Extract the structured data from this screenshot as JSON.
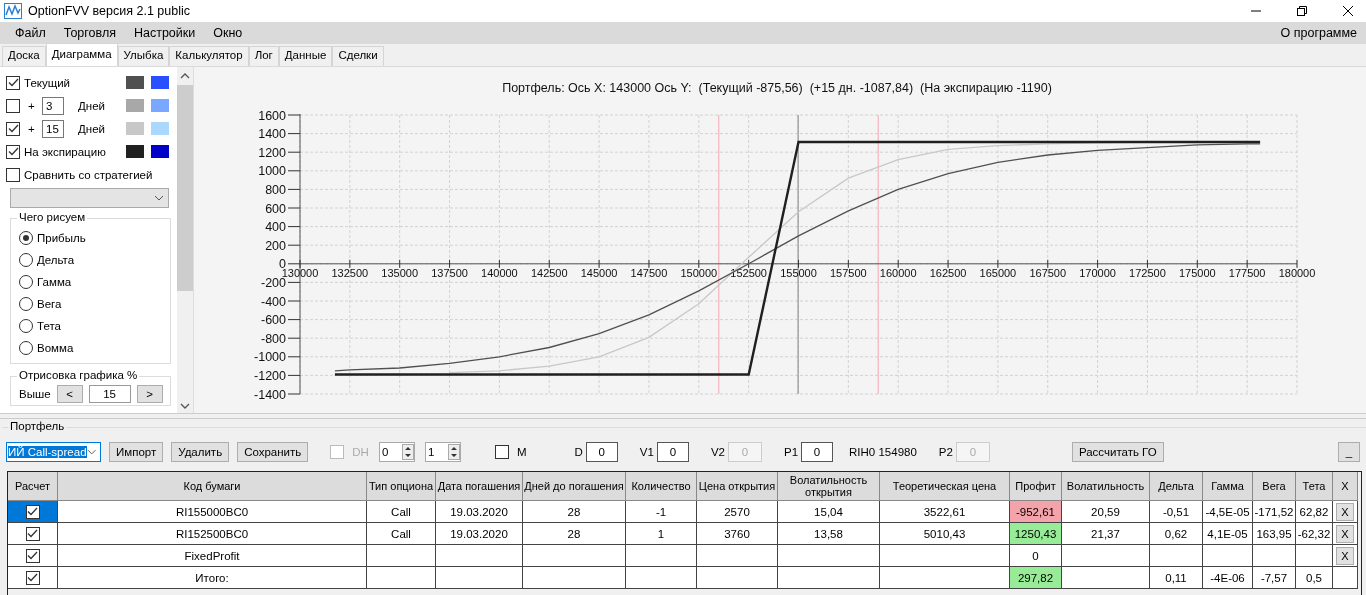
{
  "window": {
    "title": "OptionFVV версия 2.1 public"
  },
  "menu": [
    "Файл",
    "Торговля",
    "Настройки",
    "Окно"
  ],
  "menu_right": "О программе",
  "tabs": [
    {
      "label": "Доска",
      "selected": false
    },
    {
      "label": "Диаграмма",
      "selected": true
    },
    {
      "label": "Улыбка",
      "selected": false
    },
    {
      "label": "Калькулятор",
      "selected": false
    },
    {
      "label": "Лог",
      "selected": false
    },
    {
      "label": "Данные",
      "selected": false
    },
    {
      "label": "Сделки",
      "selected": false
    }
  ],
  "curves": [
    {
      "kind": "plain",
      "label": "Текущий",
      "checked": true,
      "swatches": [
        {
          "color": "#505050"
        },
        {
          "color": "#2a4fff"
        }
      ]
    },
    {
      "kind": "days",
      "prefix": "+",
      "days": "3",
      "unit": "Дней",
      "checked": false,
      "swatches": [
        {
          "color": "#a8a8a8"
        },
        {
          "color": "#7aa7ff"
        }
      ]
    },
    {
      "kind": "days",
      "prefix": "+",
      "days": "15",
      "unit": "Дней",
      "checked": true,
      "swatches": [
        {
          "color": "#c8c8c8"
        },
        {
          "color": "#aad8ff"
        }
      ]
    },
    {
      "kind": "plain",
      "label": "На экспирацию",
      "checked": true,
      "swatches": [
        {
          "color": "#202020"
        },
        {
          "color": "#0000c8"
        }
      ]
    }
  ],
  "compare": {
    "label": "Сравнить со стратегией",
    "checked": false
  },
  "strategy_select": {
    "disabled": true
  },
  "plot_group": {
    "title": "Чего рисуем",
    "options": [
      {
        "label": "Прибыль",
        "selected": true
      },
      {
        "label": "Дельта",
        "selected": false
      },
      {
        "label": "Гамма",
        "selected": false
      },
      {
        "label": "Вега",
        "selected": false
      },
      {
        "label": "Тета",
        "selected": false
      },
      {
        "label": "Вомма",
        "selected": false
      }
    ]
  },
  "range_group": {
    "title": "Отрисовка графика %",
    "label": "Выше",
    "dec": "<",
    "value": "15",
    "inc": ">"
  },
  "chart": {
    "chart_data": {
      "type": "line",
      "title": "Портфель: Ось X: 143000 Ось Y:  (Текущий -875,56)  (+15 дн. -1087,84)  (На экспирацию -1190)",
      "x": [
        131750,
        132500,
        135000,
        137500,
        140000,
        142500,
        145000,
        147500,
        150000,
        152500,
        155000,
        157500,
        160000,
        162500,
        165000,
        167500,
        170000,
        172500,
        175000,
        177500,
        178150
      ],
      "series": [
        {
          "color": "#c8c8c8",
          "values": [
            null,
            null,
            null,
            -1170,
            -1150,
            -1100,
            -1000,
            -790,
            -430,
            70,
            560,
            920,
            1120,
            1230,
            1270,
            1290,
            1300,
            1310,
            1310,
            1310,
            1310
          ]
        },
        {
          "color": "#505050",
          "values": [
            -1150,
            -1140,
            -1120,
            -1070,
            -1000,
            -900,
            -750,
            -550,
            -290,
            0,
            300,
            570,
            800,
            970,
            1090,
            1170,
            1220,
            1250,
            1280,
            1290,
            1290
          ]
        },
        {
          "color": "#202020",
          "values": [
            -1190,
            -1190,
            -1190,
            -1190,
            -1190,
            -1190,
            -1190,
            -1190,
            -1190,
            -1190,
            1310,
            1310,
            1310,
            1310,
            1310,
            1310,
            1310,
            1310,
            1310,
            1310,
            1310
          ]
        }
      ],
      "xlim": [
        130000,
        180000
      ],
      "ylim": [
        -1400,
        1600
      ],
      "grid": true,
      "xticks": [
        130000,
        132500,
        135000,
        137500,
        140000,
        142500,
        145000,
        147500,
        150000,
        152500,
        155000,
        157500,
        160000,
        162500,
        165000,
        167500,
        170000,
        172500,
        175000,
        177500,
        180000
      ],
      "yticks": [
        -1400,
        -1200,
        -1000,
        -800,
        -600,
        -400,
        -200,
        0,
        200,
        400,
        600,
        800,
        1000,
        1200,
        1400,
        1600
      ],
      "ref_lines": [
        {
          "axis": "x",
          "value": 151000,
          "color": "#f4b8c4"
        },
        {
          "axis": "x",
          "value": 159000,
          "color": "#f4b8c4"
        },
        {
          "axis": "x",
          "value": 154980,
          "color": "#9a9a9a"
        }
      ]
    }
  },
  "portfolio": {
    "title": "Портфель",
    "strategy": "ИЙ Call-spread",
    "buttons": [
      "Импорт",
      "Удалить",
      "Сохранить"
    ],
    "dh": {
      "label": "DH",
      "checked": false,
      "disabled": true
    },
    "spinners": [
      "0",
      "1"
    ],
    "m": {
      "label": "M",
      "checked": false
    },
    "items": [
      {
        "kind": "field",
        "label": "D",
        "value": "0",
        "disabled": false
      },
      {
        "kind": "field",
        "label": "V1",
        "value": "0",
        "disabled": false
      },
      {
        "kind": "field",
        "label": "V2",
        "value": "0",
        "disabled": true
      },
      {
        "kind": "field",
        "label": "P1",
        "value": "0",
        "disabled": false
      },
      {
        "kind": "text",
        "text": "RIH0 154980"
      },
      {
        "kind": "field",
        "label": "P2",
        "value": "0",
        "disabled": true
      }
    ],
    "go_button": "Рассчитать ГО",
    "collapse_button": "_"
  },
  "table": {
    "columns": [
      "Расчет",
      "Код бумаги",
      "Тип опциона",
      "Дата погашения",
      "Дней до погашения",
      "Количество",
      "Цена открытия",
      "Волатильность открытия",
      "Теоретическая цена",
      "Профит",
      "Волатильность",
      "Дельта",
      "Гамма",
      "Вега",
      "Тета",
      "X"
    ],
    "rows": [
      {
        "checked": true,
        "selected": true,
        "code": "RI155000BC0",
        "type": "Call",
        "date": "19.03.2020",
        "days": "28",
        "qty": "-1",
        "open_price": "2570",
        "open_vol": "15,04",
        "theo": "3522,61",
        "profit": {
          "text": "-952,61",
          "color": "#f4a3aa"
        },
        "vol": "20,59",
        "delta": "-0,51",
        "gamma": "-4,5E-05",
        "vega": "-171,52",
        "theta": "62,82",
        "remove": "X"
      },
      {
        "checked": true,
        "selected": false,
        "code": "RI152500BC0",
        "type": "Call",
        "date": "19.03.2020",
        "days": "28",
        "qty": "1",
        "open_price": "3760",
        "open_vol": "13,58",
        "theo": "5010,43",
        "profit": {
          "text": "1250,43",
          "color": "#98ec98"
        },
        "vol": "21,37",
        "delta": "0,62",
        "gamma": "4,1E-05",
        "vega": "163,95",
        "theta": "-62,32",
        "remove": "X"
      },
      {
        "checked": true,
        "selected": false,
        "code": "FixedProfit",
        "profit": {
          "text": "0"
        },
        "remove": "X"
      },
      {
        "checked": true,
        "selected": false,
        "code": "Итого:",
        "profit": {
          "text": "297,82",
          "color": "#98ec98"
        },
        "delta": "0,11",
        "gamma": "-4E-06",
        "vega": "-7,57",
        "theta": "0,5"
      }
    ]
  }
}
